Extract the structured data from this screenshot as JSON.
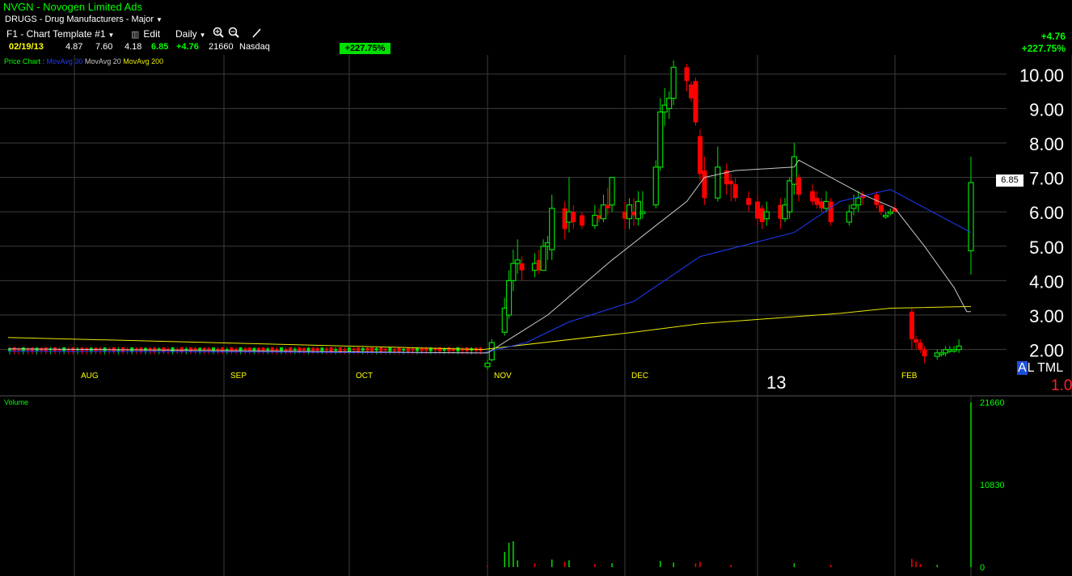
{
  "header": {
    "title": "NVGN - Novogen Limited Ads",
    "industry": "DRUGS - Drug Manufacturers - Major",
    "template": "F1 - Chart Template #1",
    "edit_label": "Edit",
    "period": "Daily"
  },
  "quote": {
    "date": "02/19/13",
    "open": "4.87",
    "high": "7.60",
    "low": "4.18",
    "close": "6.85",
    "change": "+4.76",
    "volume": "21660",
    "exchange": "Nasdaq",
    "change_pct_badge": "+227.75%"
  },
  "right_summary": {
    "change": "+4.76",
    "percent": "+227.75%"
  },
  "legend": {
    "price_chart": "Price Chart :",
    "ma30": "MovAvg 30",
    "ma20": "MovAvg 20",
    "ma200": "MovAvg 200"
  },
  "price_tag": "6.85",
  "year_label": "13",
  "altml_label_a": "A",
  "altml_label_rest": "L TML",
  "one_label": "1.0",
  "volume_label": "Volume",
  "colors": {
    "up": "#00e000",
    "down": "#ff0000",
    "ma30": "#1e3cff",
    "ma20": "#c8c8c8",
    "ma200": "#e8e800",
    "grid": "#3c3c3c",
    "background": "#000000"
  },
  "chart_data": [
    {
      "type": "candlestick",
      "title": "NVGN - Novogen Limited Ads",
      "period": "Daily",
      "ylim": [
        1.3,
        10.4
      ],
      "y_ticks": [
        "10.00",
        "9.00",
        "8.00",
        "7.00",
        "6.00",
        "5.00",
        "4.00",
        "3.00",
        "2.00"
      ],
      "x_labels": [
        {
          "label": "AUG",
          "date": "2012-08-01"
        },
        {
          "label": "SEP",
          "date": "2012-09-04"
        },
        {
          "label": "OCT",
          "date": "2012-10-01"
        },
        {
          "label": "NOV",
          "date": "2012-11-01"
        },
        {
          "label": "DEC",
          "date": "2012-12-03"
        },
        {
          "label": "13",
          "date": "2013-01-02"
        },
        {
          "label": "FEB",
          "date": "2013-02-01"
        }
      ],
      "candles": [
        {
          "date": "2012-11-01",
          "o": 1.5,
          "h": 1.7,
          "l": 1.4,
          "c": 1.6
        },
        {
          "date": "2012-11-02",
          "o": 1.7,
          "h": 2.3,
          "l": 1.65,
          "c": 2.2
        },
        {
          "date": "2012-11-05",
          "o": 2.5,
          "h": 3.5,
          "l": 2.4,
          "c": 3.2
        },
        {
          "date": "2012-11-06",
          "o": 3.0,
          "h": 4.3,
          "l": 2.9,
          "c": 4.0
        },
        {
          "date": "2012-11-07",
          "o": 4.0,
          "h": 4.9,
          "l": 3.7,
          "c": 4.5
        },
        {
          "date": "2012-11-08",
          "o": 4.5,
          "h": 5.2,
          "l": 4.2,
          "c": 4.6
        },
        {
          "date": "2012-11-09",
          "o": 4.5,
          "h": 4.7,
          "l": 4.0,
          "c": 4.3
        },
        {
          "date": "2012-11-12",
          "o": 4.3,
          "h": 4.8,
          "l": 4.1,
          "c": 4.5
        },
        {
          "date": "2012-11-13",
          "o": 4.6,
          "h": 4.9,
          "l": 4.2,
          "c": 4.3
        },
        {
          "date": "2012-11-14",
          "o": 4.3,
          "h": 5.2,
          "l": 4.3,
          "c": 5.0
        },
        {
          "date": "2012-11-15",
          "o": 5.0,
          "h": 5.3,
          "l": 4.6,
          "c": 5.1
        },
        {
          "date": "2012-11-16",
          "o": 4.9,
          "h": 6.5,
          "l": 4.6,
          "c": 6.1
        },
        {
          "date": "2012-11-19",
          "o": 6.1,
          "h": 6.3,
          "l": 5.2,
          "c": 5.5
        },
        {
          "date": "2012-11-20",
          "o": 5.7,
          "h": 7.0,
          "l": 5.4,
          "c": 6.0
        },
        {
          "date": "2012-11-21",
          "o": 6.0,
          "h": 6.2,
          "l": 5.5,
          "c": 5.7
        },
        {
          "date": "2012-11-23",
          "o": 5.9,
          "h": 6.0,
          "l": 5.5,
          "c": 5.6
        },
        {
          "date": "2012-11-26",
          "o": 5.6,
          "h": 6.2,
          "l": 5.5,
          "c": 5.9
        },
        {
          "date": "2012-11-27",
          "o": 5.9,
          "h": 6.1,
          "l": 5.7,
          "c": 5.8
        },
        {
          "date": "2012-11-28",
          "o": 5.8,
          "h": 6.5,
          "l": 5.7,
          "c": 6.2
        },
        {
          "date": "2012-11-29",
          "o": 6.2,
          "h": 6.7,
          "l": 5.9,
          "c": 6.1
        },
        {
          "date": "2012-11-30",
          "o": 6.2,
          "h": 7.0,
          "l": 6.0,
          "c": 7.0
        },
        {
          "date": "2012-12-03",
          "o": 6.0,
          "h": 6.3,
          "l": 5.5,
          "c": 5.8
        },
        {
          "date": "2012-12-04",
          "o": 5.8,
          "h": 6.4,
          "l": 5.5,
          "c": 6.2
        },
        {
          "date": "2012-12-05",
          "o": 6.0,
          "h": 6.4,
          "l": 5.6,
          "c": 5.9
        },
        {
          "date": "2012-12-06",
          "o": 5.8,
          "h": 6.6,
          "l": 5.6,
          "c": 6.3
        },
        {
          "date": "2012-12-07",
          "o": 6.0,
          "h": 6.6,
          "l": 5.8,
          "c": 6.0
        },
        {
          "date": "2012-12-10",
          "o": 6.2,
          "h": 7.5,
          "l": 6.1,
          "c": 7.3
        },
        {
          "date": "2012-12-11",
          "o": 7.3,
          "h": 9.3,
          "l": 7.2,
          "c": 8.9
        },
        {
          "date": "2012-12-12",
          "o": 8.9,
          "h": 9.6,
          "l": 8.5,
          "c": 9.1
        },
        {
          "date": "2012-12-13",
          "o": 9.0,
          "h": 9.5,
          "l": 8.7,
          "c": 9.3
        },
        {
          "date": "2012-12-14",
          "o": 9.3,
          "h": 10.4,
          "l": 9.1,
          "c": 10.2
        },
        {
          "date": "2012-12-17",
          "o": 10.2,
          "h": 10.3,
          "l": 9.5,
          "c": 9.8
        },
        {
          "date": "2012-12-18",
          "o": 9.7,
          "h": 9.8,
          "l": 9.2,
          "c": 9.3
        },
        {
          "date": "2012-12-19",
          "o": 9.8,
          "h": 9.9,
          "l": 8.5,
          "c": 8.6
        },
        {
          "date": "2012-12-20",
          "o": 8.2,
          "h": 8.4,
          "l": 6.9,
          "c": 7.1
        },
        {
          "date": "2012-12-21",
          "o": 7.2,
          "h": 7.6,
          "l": 6.2,
          "c": 6.4
        },
        {
          "date": "2012-12-24",
          "o": 6.4,
          "h": 7.9,
          "l": 6.3,
          "c": 7.3
        },
        {
          "date": "2012-12-26",
          "o": 7.2,
          "h": 7.4,
          "l": 6.5,
          "c": 6.8
        },
        {
          "date": "2012-12-27",
          "o": 6.9,
          "h": 7.1,
          "l": 6.3,
          "c": 6.8
        },
        {
          "date": "2012-12-28",
          "o": 6.8,
          "h": 7.0,
          "l": 6.3,
          "c": 6.4
        },
        {
          "date": "2012-12-31",
          "o": 6.4,
          "h": 6.6,
          "l": 6.0,
          "c": 6.2
        },
        {
          "date": "2013-01-02",
          "o": 6.3,
          "h": 6.5,
          "l": 5.6,
          "c": 5.8
        },
        {
          "date": "2013-01-03",
          "o": 6.1,
          "h": 6.2,
          "l": 5.5,
          "c": 5.7
        },
        {
          "date": "2013-01-04",
          "o": 5.8,
          "h": 6.3,
          "l": 5.6,
          "c": 6.0
        },
        {
          "date": "2013-01-07",
          "o": 6.2,
          "h": 6.4,
          "l": 5.5,
          "c": 5.8
        },
        {
          "date": "2013-01-08",
          "o": 5.8,
          "h": 6.4,
          "l": 5.7,
          "c": 6.2
        },
        {
          "date": "2013-01-09",
          "o": 6.0,
          "h": 7.0,
          "l": 5.8,
          "c": 6.9
        },
        {
          "date": "2013-01-10",
          "o": 6.8,
          "h": 8.0,
          "l": 6.5,
          "c": 7.6
        },
        {
          "date": "2013-01-11",
          "o": 7.0,
          "h": 7.1,
          "l": 6.3,
          "c": 6.5
        },
        {
          "date": "2013-01-14",
          "o": 6.6,
          "h": 6.8,
          "l": 6.2,
          "c": 6.3
        },
        {
          "date": "2013-01-15",
          "o": 6.4,
          "h": 6.6,
          "l": 6.1,
          "c": 6.2
        },
        {
          "date": "2013-01-16",
          "o": 6.3,
          "h": 6.4,
          "l": 6.0,
          "c": 6.1
        },
        {
          "date": "2013-01-17",
          "o": 6.1,
          "h": 6.6,
          "l": 6.0,
          "c": 6.3
        },
        {
          "date": "2013-01-18",
          "o": 6.3,
          "h": 6.4,
          "l": 5.6,
          "c": 5.7
        },
        {
          "date": "2013-01-22",
          "o": 5.7,
          "h": 6.2,
          "l": 5.6,
          "c": 6.0
        },
        {
          "date": "2013-01-23",
          "o": 6.1,
          "h": 6.5,
          "l": 5.9,
          "c": 6.2
        },
        {
          "date": "2013-01-24",
          "o": 6.2,
          "h": 6.6,
          "l": 6.0,
          "c": 6.4
        },
        {
          "date": "2013-01-25",
          "o": 6.5,
          "h": 6.6,
          "l": 6.2,
          "c": 6.4
        },
        {
          "date": "2013-01-28",
          "o": 6.5,
          "h": 6.6,
          "l": 6.1,
          "c": 6.2
        },
        {
          "date": "2013-01-29",
          "o": 6.2,
          "h": 6.3,
          "l": 5.9,
          "c": 6.0
        },
        {
          "date": "2013-01-30",
          "o": 5.9,
          "h": 6.0,
          "l": 5.8,
          "c": 5.9
        },
        {
          "date": "2013-01-31",
          "o": 6.0,
          "h": 6.1,
          "l": 5.9,
          "c": 6.0
        },
        {
          "date": "2013-02-01",
          "o": 6.1,
          "h": 6.2,
          "l": 6.0,
          "c": 6.0
        },
        {
          "date": "2013-02-05",
          "o": 3.1,
          "h": 3.2,
          "l": 2.0,
          "c": 2.3
        },
        {
          "date": "2013-02-06",
          "o": 2.3,
          "h": 2.4,
          "l": 2.0,
          "c": 2.2
        },
        {
          "date": "2013-02-07",
          "o": 2.2,
          "h": 2.3,
          "l": 1.9,
          "c": 2.0
        },
        {
          "date": "2013-02-08",
          "o": 2.0,
          "h": 2.1,
          "l": 1.6,
          "c": 1.8
        },
        {
          "date": "2013-02-11",
          "o": 1.8,
          "h": 2.0,
          "l": 1.7,
          "c": 1.9
        },
        {
          "date": "2013-02-12",
          "o": 1.9,
          "h": 2.0,
          "l": 1.8,
          "c": 1.9
        },
        {
          "date": "2013-02-13",
          "o": 1.9,
          "h": 2.1,
          "l": 1.8,
          "c": 2.0
        },
        {
          "date": "2013-02-14",
          "o": 2.0,
          "h": 2.1,
          "l": 1.9,
          "c": 2.0
        },
        {
          "date": "2013-02-15",
          "o": 2.0,
          "h": 2.1,
          "l": 1.9,
          "c": 2.0
        },
        {
          "date": "2013-02-15b",
          "o": 2.0,
          "h": 2.3,
          "l": 1.9,
          "c": 2.1
        },
        {
          "date": "2013-02-19",
          "o": 4.87,
          "h": 7.6,
          "l": 4.18,
          "c": 6.85
        }
      ],
      "flat_period": {
        "start": "2012-07-10",
        "end": "2012-10-31",
        "level": 1.98
      },
      "ma20": [
        {
          "date": "2012-07-10",
          "v": 2.02
        },
        {
          "date": "2012-10-31",
          "v": 1.9
        },
        {
          "date": "2012-11-01",
          "v": 1.9
        },
        {
          "date": "2012-11-15",
          "v": 3.0
        },
        {
          "date": "2012-11-30",
          "v": 4.6
        },
        {
          "date": "2012-12-10",
          "v": 5.6
        },
        {
          "date": "2012-12-17",
          "v": 6.3
        },
        {
          "date": "2012-12-21",
          "v": 7.0
        },
        {
          "date": "2012-12-28",
          "v": 7.2
        },
        {
          "date": "2013-01-10",
          "v": 7.3
        },
        {
          "date": "2013-01-11",
          "v": 7.5
        },
        {
          "date": "2013-01-18",
          "v": 7.0
        },
        {
          "date": "2013-01-25",
          "v": 6.5
        },
        {
          "date": "2013-02-01",
          "v": 6.1
        },
        {
          "date": "2013-02-08",
          "v": 5.0
        },
        {
          "date": "2013-02-15",
          "v": 3.8
        },
        {
          "date": "2013-02-18",
          "v": 3.1
        },
        {
          "date": "2013-02-19",
          "v": 3.1
        }
      ],
      "ma30": [
        {
          "date": "2012-07-10",
          "v": 1.95
        },
        {
          "date": "2012-10-31",
          "v": 1.9
        },
        {
          "date": "2012-11-10",
          "v": 2.2
        },
        {
          "date": "2012-11-20",
          "v": 2.8
        },
        {
          "date": "2012-12-05",
          "v": 3.4
        },
        {
          "date": "2012-12-20",
          "v": 4.7
        },
        {
          "date": "2013-01-10",
          "v": 5.4
        },
        {
          "date": "2013-01-20",
          "v": 6.3
        },
        {
          "date": "2013-01-31",
          "v": 6.65
        },
        {
          "date": "2013-02-19",
          "v": 5.4
        }
      ],
      "ma200": [
        {
          "date": "2012-07-10",
          "v": 2.35
        },
        {
          "date": "2012-10-31",
          "v": 2.0
        },
        {
          "date": "2012-12-05",
          "v": 2.5
        },
        {
          "date": "2012-12-20",
          "v": 2.75
        },
        {
          "date": "2013-01-20",
          "v": 3.05
        },
        {
          "date": "2013-01-31",
          "v": 3.2
        },
        {
          "date": "2013-02-19",
          "v": 3.25
        }
      ]
    },
    {
      "type": "bar",
      "title": "Volume",
      "ylim": [
        0,
        21660
      ],
      "y_ticks": [
        "21660",
        "10830",
        "0"
      ],
      "bars": [
        {
          "date": "2012-11-01",
          "v": 200,
          "up": false
        },
        {
          "date": "2012-11-05",
          "v": 2000,
          "up": true
        },
        {
          "date": "2012-11-06",
          "v": 3200,
          "up": true
        },
        {
          "date": "2012-11-07",
          "v": 3400,
          "up": true
        },
        {
          "date": "2012-11-08",
          "v": 900,
          "up": true
        },
        {
          "date": "2012-11-12",
          "v": 500,
          "up": false
        },
        {
          "date": "2012-11-16",
          "v": 1000,
          "up": true
        },
        {
          "date": "2012-11-19",
          "v": 700,
          "up": false
        },
        {
          "date": "2012-11-20",
          "v": 900,
          "up": true
        },
        {
          "date": "2012-11-26",
          "v": 400,
          "up": false
        },
        {
          "date": "2012-11-30",
          "v": 500,
          "up": true
        },
        {
          "date": "2012-12-11",
          "v": 800,
          "up": true
        },
        {
          "date": "2012-12-14",
          "v": 600,
          "up": true
        },
        {
          "date": "2012-12-19",
          "v": 500,
          "up": false
        },
        {
          "date": "2012-12-20",
          "v": 700,
          "up": false
        },
        {
          "date": "2012-12-27",
          "v": 300,
          "up": false
        },
        {
          "date": "2013-01-10",
          "v": 500,
          "up": true
        },
        {
          "date": "2013-01-18",
          "v": 300,
          "up": false
        },
        {
          "date": "2013-02-05",
          "v": 1100,
          "up": false
        },
        {
          "date": "2013-02-06",
          "v": 700,
          "up": false
        },
        {
          "date": "2013-02-07",
          "v": 400,
          "up": false
        },
        {
          "date": "2013-02-11",
          "v": 300,
          "up": true
        },
        {
          "date": "2013-02-19",
          "v": 21660,
          "up": true
        }
      ]
    }
  ]
}
